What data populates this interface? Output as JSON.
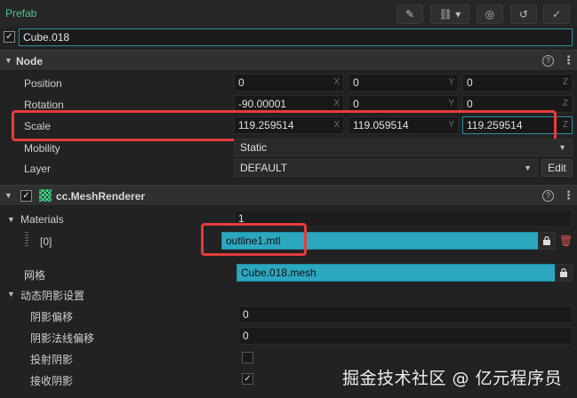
{
  "prefab": {
    "label": "Prefab",
    "tools": [
      {
        "name": "edit-icon",
        "glyph": "✎"
      },
      {
        "name": "unlink-icon",
        "glyph": "⛓ ▾"
      },
      {
        "name": "locate-icon",
        "glyph": "◎"
      },
      {
        "name": "revert-icon",
        "glyph": "↺"
      },
      {
        "name": "apply-icon",
        "glyph": "✓"
      }
    ]
  },
  "node_name": "Cube.018",
  "node_section": {
    "title": "Node",
    "position": {
      "label": "Position",
      "x": "0",
      "y": "0",
      "z": "0"
    },
    "rotation": {
      "label": "Rotation",
      "x": "-90.00001",
      "y": "0",
      "z": "0"
    },
    "scale": {
      "label": "Scale",
      "x": "119.259514",
      "y": "119.059514",
      "z": "119.259514"
    },
    "mobility": {
      "label": "Mobility",
      "value": "Static"
    },
    "layer": {
      "label": "Layer",
      "value": "DEFAULT",
      "edit_label": "Edit"
    },
    "axes": {
      "x": "X",
      "y": "Y",
      "z": "Z"
    }
  },
  "mesh_renderer": {
    "title": "cc.MeshRenderer",
    "materials_label": "Materials",
    "materials_count": "1",
    "material_index": "[0]",
    "material_value": "outline1.mtl",
    "mesh_label": "网格",
    "mesh_value": "Cube.018.mesh",
    "shadow_section_label": "动态阴影设置",
    "shadow_bias": {
      "label": "阴影偏移",
      "value": "0"
    },
    "shadow_normal_bias": {
      "label": "阴影法线偏移",
      "value": "0"
    },
    "cast_shadow": {
      "label": "投射阴影",
      "checked": false
    },
    "receive_shadow": {
      "label": "接收阴影",
      "checked": true
    }
  },
  "watermark": "掘金技术社区 @ 亿元程序员",
  "colors": {
    "accent": "#2ca7c0",
    "prefab_green": "#4fc48c",
    "highlight": "#e53c3c"
  }
}
